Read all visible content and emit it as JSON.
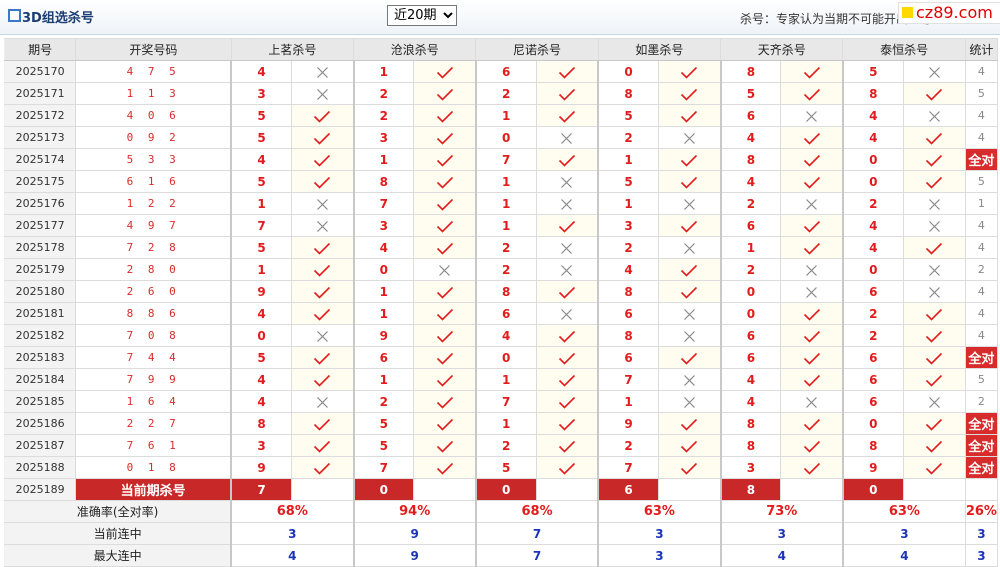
{
  "header": {
    "title": "3D组选杀号",
    "period_select_value": "近20期",
    "period_options": [
      "近20期"
    ],
    "note": "杀号：专家认为当期不可能开出的号",
    "logo_text": "cz89.com"
  },
  "columns": {
    "period": "期号",
    "draw": "开奖号码",
    "experts": [
      "上茗杀号",
      "沧浪杀号",
      "尼诺杀号",
      "如墨杀号",
      "天齐杀号",
      "泰恒杀号"
    ],
    "stat": "统计"
  },
  "rows": [
    {
      "period": "2025170",
      "draw": "4 7 5",
      "kills": [
        "4",
        "1",
        "6",
        "0",
        "8",
        "5"
      ],
      "hits": [
        false,
        true,
        true,
        true,
        true,
        false
      ],
      "stat": "4"
    },
    {
      "period": "2025171",
      "draw": "1 1 3",
      "kills": [
        "3",
        "2",
        "2",
        "8",
        "5",
        "8"
      ],
      "hits": [
        false,
        true,
        true,
        true,
        true,
        true
      ],
      "stat": "5"
    },
    {
      "period": "2025172",
      "draw": "4 0 6",
      "kills": [
        "5",
        "2",
        "1",
        "5",
        "6",
        "4"
      ],
      "hits": [
        true,
        true,
        true,
        true,
        false,
        false
      ],
      "stat": "4"
    },
    {
      "period": "2025173",
      "draw": "0 9 2",
      "kills": [
        "5",
        "3",
        "0",
        "2",
        "4",
        "4"
      ],
      "hits": [
        true,
        true,
        false,
        false,
        true,
        true
      ],
      "stat": "4"
    },
    {
      "period": "2025174",
      "draw": "5 3 3",
      "kills": [
        "4",
        "1",
        "7",
        "1",
        "8",
        "0"
      ],
      "hits": [
        true,
        true,
        true,
        true,
        true,
        true
      ],
      "stat": "全对"
    },
    {
      "period": "2025175",
      "draw": "6 1 6",
      "kills": [
        "5",
        "8",
        "1",
        "5",
        "4",
        "0"
      ],
      "hits": [
        true,
        true,
        false,
        true,
        true,
        true
      ],
      "stat": "5"
    },
    {
      "period": "2025176",
      "draw": "1 2 2",
      "kills": [
        "1",
        "7",
        "1",
        "1",
        "2",
        "2"
      ],
      "hits": [
        false,
        true,
        false,
        false,
        false,
        false
      ],
      "stat": "1"
    },
    {
      "period": "2025177",
      "draw": "4 9 7",
      "kills": [
        "7",
        "3",
        "1",
        "3",
        "6",
        "4"
      ],
      "hits": [
        false,
        true,
        true,
        true,
        true,
        false
      ],
      "stat": "4"
    },
    {
      "period": "2025178",
      "draw": "7 2 8",
      "kills": [
        "5",
        "4",
        "2",
        "2",
        "1",
        "4"
      ],
      "hits": [
        true,
        true,
        false,
        false,
        true,
        true
      ],
      "stat": "4"
    },
    {
      "period": "2025179",
      "draw": "2 8 0",
      "kills": [
        "1",
        "0",
        "2",
        "4",
        "2",
        "0"
      ],
      "hits": [
        true,
        false,
        false,
        true,
        false,
        false
      ],
      "stat": "2"
    },
    {
      "period": "2025180",
      "draw": "2 6 0",
      "kills": [
        "9",
        "1",
        "8",
        "8",
        "0",
        "6"
      ],
      "hits": [
        true,
        true,
        true,
        true,
        false,
        false
      ],
      "stat": "4"
    },
    {
      "period": "2025181",
      "draw": "8 8 6",
      "kills": [
        "4",
        "1",
        "6",
        "6",
        "0",
        "2"
      ],
      "hits": [
        true,
        true,
        false,
        false,
        true,
        true
      ],
      "stat": "4"
    },
    {
      "period": "2025182",
      "draw": "7 0 8",
      "kills": [
        "0",
        "9",
        "4",
        "8",
        "6",
        "2"
      ],
      "hits": [
        false,
        true,
        true,
        false,
        true,
        true
      ],
      "stat": "4"
    },
    {
      "period": "2025183",
      "draw": "7 4 4",
      "kills": [
        "5",
        "6",
        "0",
        "6",
        "6",
        "6"
      ],
      "hits": [
        true,
        true,
        true,
        true,
        true,
        true
      ],
      "stat": "全对"
    },
    {
      "period": "2025184",
      "draw": "7 9 9",
      "kills": [
        "4",
        "1",
        "1",
        "7",
        "4",
        "6"
      ],
      "hits": [
        true,
        true,
        true,
        false,
        true,
        true
      ],
      "stat": "5"
    },
    {
      "period": "2025185",
      "draw": "1 6 4",
      "kills": [
        "4",
        "2",
        "7",
        "1",
        "4",
        "6"
      ],
      "hits": [
        false,
        true,
        true,
        false,
        false,
        false
      ],
      "stat": "2"
    },
    {
      "period": "2025186",
      "draw": "2 2 7",
      "kills": [
        "8",
        "5",
        "1",
        "9",
        "8",
        "0"
      ],
      "hits": [
        true,
        true,
        true,
        true,
        true,
        true
      ],
      "stat": "全对"
    },
    {
      "period": "2025187",
      "draw": "7 6 1",
      "kills": [
        "3",
        "5",
        "2",
        "2",
        "8",
        "8"
      ],
      "hits": [
        true,
        true,
        true,
        true,
        true,
        true
      ],
      "stat": "全对"
    },
    {
      "period": "2025188",
      "draw": "0 1 8",
      "kills": [
        "9",
        "7",
        "5",
        "7",
        "3",
        "9"
      ],
      "hits": [
        true,
        true,
        true,
        true,
        true,
        true
      ],
      "stat": "全对"
    }
  ],
  "current": {
    "period": "2025189",
    "label": "当前期杀号",
    "kills": [
      "7",
      "0",
      "0",
      "6",
      "8",
      "0"
    ]
  },
  "summary": {
    "accuracy_label": "准确率(全对率)",
    "accuracy": [
      "68%",
      "94%",
      "68%",
      "63%",
      "73%",
      "63%"
    ],
    "accuracy_stat": "26%",
    "current_streak_label": "当前连中",
    "current_streak": [
      "3",
      "9",
      "7",
      "3",
      "3",
      "3"
    ],
    "current_streak_stat": "3",
    "max_streak_label": "最大连中",
    "max_streak": [
      "4",
      "9",
      "7",
      "3",
      "4",
      "4"
    ],
    "max_streak_stat": "3"
  },
  "colors": {
    "accent_red": "#c82828",
    "hit_check": "#e21c1c",
    "miss_x": "#888888",
    "count_blue": "#1c35b8"
  }
}
